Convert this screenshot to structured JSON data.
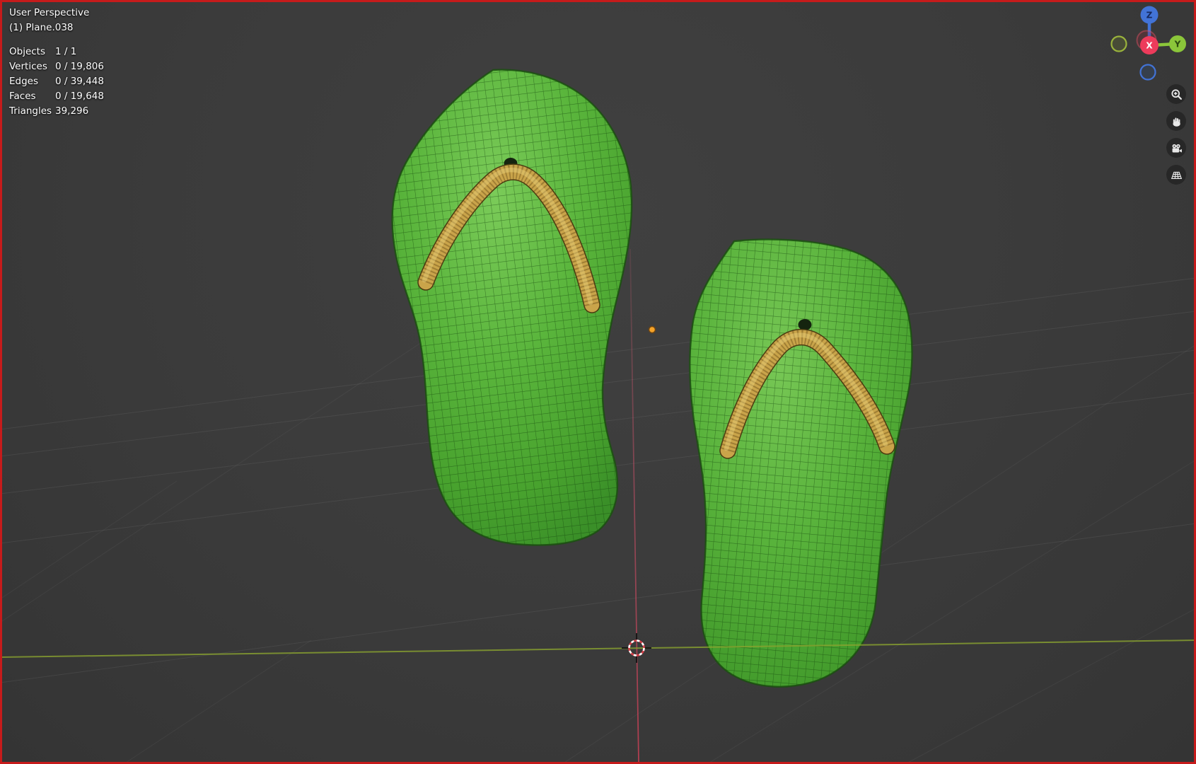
{
  "window": {
    "app": "Blender 3D viewport",
    "border_color": "#c61b1b",
    "viewport_background": "#3b3b3b"
  },
  "header": {
    "view_label": "User Perspective",
    "object_label": "(1) Plane.038"
  },
  "stats": {
    "rows": [
      {
        "label": "Objects",
        "value": "1 / 1"
      },
      {
        "label": "Vertices",
        "value": "0 / 19,806"
      },
      {
        "label": "Edges",
        "value": "0 / 39,448"
      },
      {
        "label": "Faces",
        "value": "0 / 19,648"
      },
      {
        "label": "Triangles",
        "value": "39,296"
      }
    ]
  },
  "gizmo": {
    "axis_x_label": "X",
    "axis_y_label": "Y",
    "axis_z_label": "Z",
    "colors": {
      "x": "#ed3b5b",
      "y": "#8bc63a",
      "z": "#4273d6"
    }
  },
  "nav": {
    "buttons": [
      {
        "name": "zoom",
        "icon": "magnifier-plus-icon"
      },
      {
        "name": "pan",
        "icon": "hand-icon"
      },
      {
        "name": "camera-view",
        "icon": "camera-icon"
      },
      {
        "name": "projection",
        "icon": "grid-icon"
      }
    ]
  },
  "scene": {
    "objects": [
      "flip-flop-left",
      "flip-flop-right"
    ],
    "colors": {
      "sole_green": "#5ab53c",
      "sole_wireframe": "#16490c",
      "strap_tan": "#c9a44a",
      "axis_x_line": "#c75a6e",
      "axis_y_line": "#8aa32f",
      "cursor_red": "#d8404a",
      "origin_orange": "#f5a329"
    }
  }
}
